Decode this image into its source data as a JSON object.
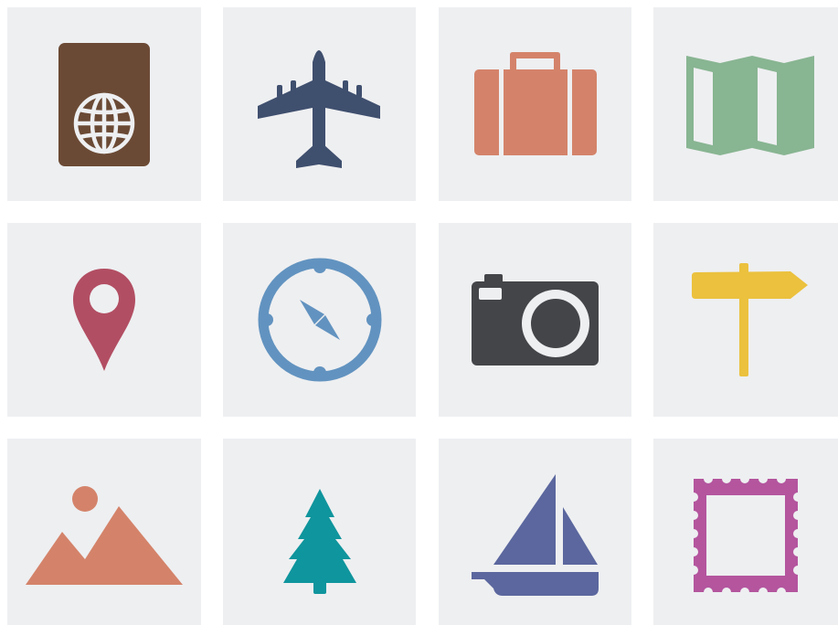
{
  "colors": {
    "tile_background": "#eeeff1",
    "page_background": "#ffffff",
    "passport": "#6b4a35",
    "airplane": "#3f4f6e",
    "suitcase": "#d4836a",
    "map": "#88b592",
    "location_pin": "#b24e63",
    "compass": "#6293c0",
    "camera": "#434548",
    "signpost": "#ebc13e",
    "mountains": "#d4836a",
    "tree": "#0f959d",
    "sailboat": "#5b679e",
    "stamp": "#b4559e"
  },
  "tiles": [
    {
      "icon": "passport-icon"
    },
    {
      "icon": "airplane-icon"
    },
    {
      "icon": "suitcase-icon"
    },
    {
      "icon": "map-icon"
    },
    {
      "icon": "location-pin-icon"
    },
    {
      "icon": "compass-icon"
    },
    {
      "icon": "camera-icon"
    },
    {
      "icon": "signpost-icon"
    },
    {
      "icon": "mountains-icon"
    },
    {
      "icon": "tree-icon"
    },
    {
      "icon": "sailboat-icon"
    },
    {
      "icon": "stamp-icon"
    }
  ]
}
